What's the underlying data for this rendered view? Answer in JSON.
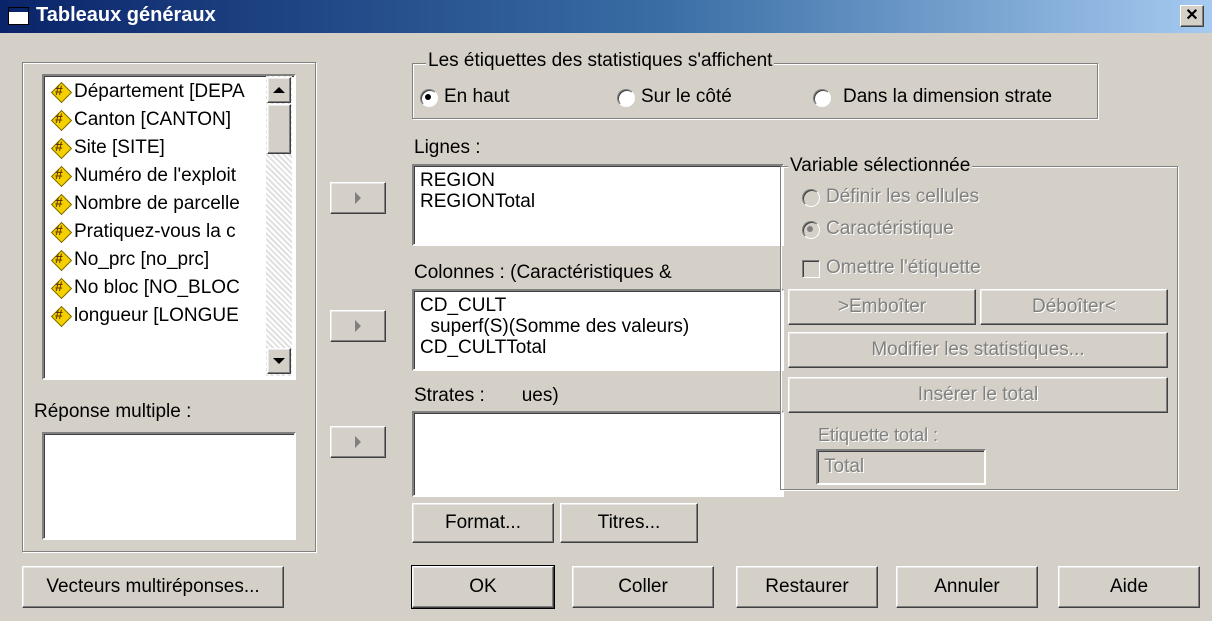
{
  "window": {
    "title": "Tableaux généraux",
    "close_glyph": "✕"
  },
  "variables": {
    "items": [
      "Département [DEPA",
      "Canton [CANTON]",
      "Site [SITE]",
      "Numéro de l'exploit",
      "Nombre de parcelle",
      "Pratiquez-vous la c",
      "No_prc [no_prc]",
      "No bloc [NO_BLOC",
      "longueur [LONGUE"
    ]
  },
  "multiple_response": {
    "label": "Réponse multiple :"
  },
  "stats_labels": {
    "group_label": "Les étiquettes des statistiques s'affichent",
    "options": [
      "En haut",
      "Sur le côté",
      "Dans la dimension strate"
    ],
    "selected": 0
  },
  "lignes": {
    "label": "Lignes :",
    "lines": [
      "REGION",
      "REGIONTotal"
    ]
  },
  "colonnes": {
    "label": "Colonnes :   (Caractéristiques &",
    "lines": [
      "CD_CULT",
      "  superf(S)(Somme des valeurs)",
      "CD_CULTTotal"
    ]
  },
  "strates": {
    "label": "Strates :       ues)",
    "lines": []
  },
  "selected_variable": {
    "group_label": "Variable sélectionnée",
    "options": [
      "Définir les cellules",
      "Caractéristique"
    ],
    "selected": 1,
    "omit_label": "Omettre l'étiquette",
    "emboiter": ">Emboîter",
    "deboiter": "Déboîter<",
    "modify_stats": "Modifier les statistiques...",
    "insert_total": "Insérer le total",
    "total_label_caption": "Etiquette total :",
    "total_label_value": "Total"
  },
  "buttons": {
    "vecteurs": "Vecteurs multiréponses...",
    "format": "Format...",
    "titres": "Titres...",
    "ok": "OK",
    "coller": "Coller",
    "restaurer": "Restaurer",
    "annuler": "Annuler",
    "aide": "Aide"
  }
}
